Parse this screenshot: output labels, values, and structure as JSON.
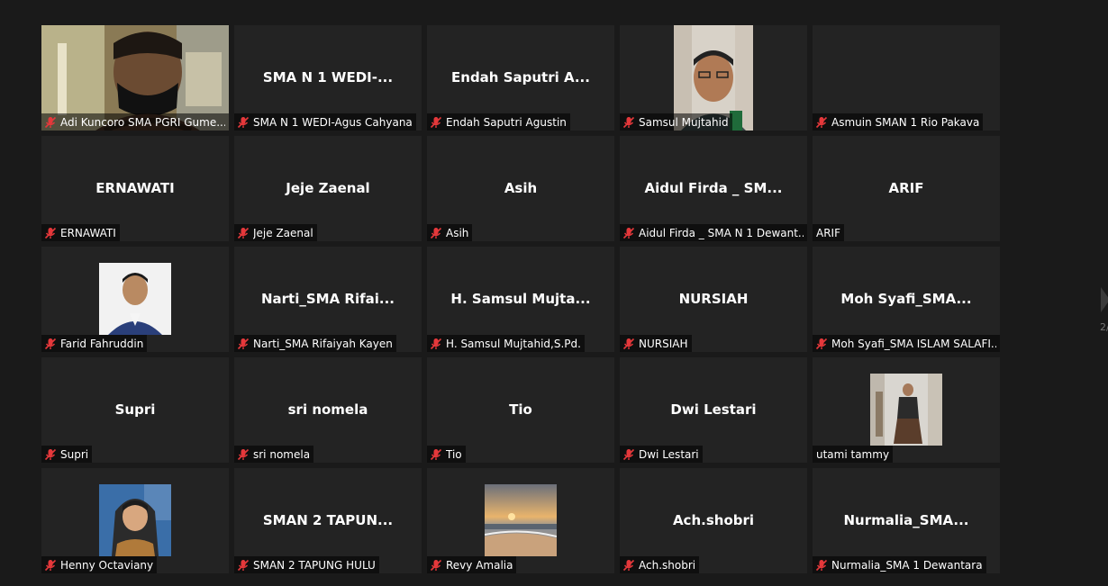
{
  "participants": [
    {
      "display": "",
      "caption": "Adi Kuncoro SMA PGRI Gume...",
      "muted": true,
      "video": "webcam-man-mask"
    },
    {
      "display": "SMA  N  1  WEDI-...",
      "caption": "SMA N 1 WEDI-Agus Cahyana",
      "muted": true
    },
    {
      "display": "Endah  Saputri  A...",
      "caption": "Endah Saputri Agustin",
      "muted": true
    },
    {
      "display": "",
      "caption": "Samsul Mujtahid",
      "muted": true,
      "video": "webcam-man-glasses"
    },
    {
      "display": "",
      "caption": "Asmuin SMAN 1 Rio Pakava",
      "muted": true
    },
    {
      "display": "ERNAWATI",
      "caption": "ERNAWATI",
      "muted": true
    },
    {
      "display": "Jeje Zaenal",
      "caption": "Jeje Zaenal",
      "muted": true
    },
    {
      "display": "Asih",
      "caption": "Asih",
      "muted": true
    },
    {
      "display": "Aidul  Firda  _  SM...",
      "caption": "Aidul Firda _ SMA N 1 Dewant...",
      "muted": true
    },
    {
      "display": "ARIF",
      "caption": "ARIF",
      "muted": false
    },
    {
      "display": "",
      "caption": "Farid Fahruddin",
      "muted": true,
      "video": "profile-photo-man"
    },
    {
      "display": "Narti_SMA  Rifai...",
      "caption": "Narti_SMA Rifaiyah Kayen",
      "muted": true
    },
    {
      "display": "H.  Samsul  Mujta...",
      "caption": "H. Samsul Mujtahid,S.Pd.",
      "muted": true
    },
    {
      "display": "NURSIAH",
      "caption": "NURSIAH",
      "muted": true
    },
    {
      "display": "Moh  Syafi_SMA...",
      "caption": "Moh Syafi_SMA ISLAM SALAFI...",
      "muted": true
    },
    {
      "display": "Supri",
      "caption": "Supri",
      "muted": true
    },
    {
      "display": "sri nomela",
      "caption": "sri nomela",
      "muted": true
    },
    {
      "display": "Tio",
      "caption": "Tio",
      "muted": true
    },
    {
      "display": "Dwi Lestari",
      "caption": "Dwi Lestari",
      "muted": true
    },
    {
      "display": "",
      "caption": "utami tammy",
      "muted": false,
      "video": "profile-photo-woman-standing"
    },
    {
      "display": "",
      "caption": "Henny Octaviany",
      "muted": true,
      "video": "profile-photo-woman-hijab"
    },
    {
      "display": "SMAN  2  TAPUN...",
      "caption": "SMAN 2 TAPUNG HULU",
      "muted": true
    },
    {
      "display": "",
      "caption": "Revy Amalia",
      "muted": true,
      "video": "profile-photo-beach-sunset"
    },
    {
      "display": "Ach.shobri",
      "caption": "Ach.shobri",
      "muted": true
    },
    {
      "display": "Nurmalia_SMA...",
      "caption": "Nurmalia_SMA 1 Dewantara",
      "muted": true
    }
  ],
  "pager": {
    "label": "2/"
  },
  "colors": {
    "tile": "#232323",
    "background": "#1a1a1a",
    "mute": "#e5383b"
  }
}
